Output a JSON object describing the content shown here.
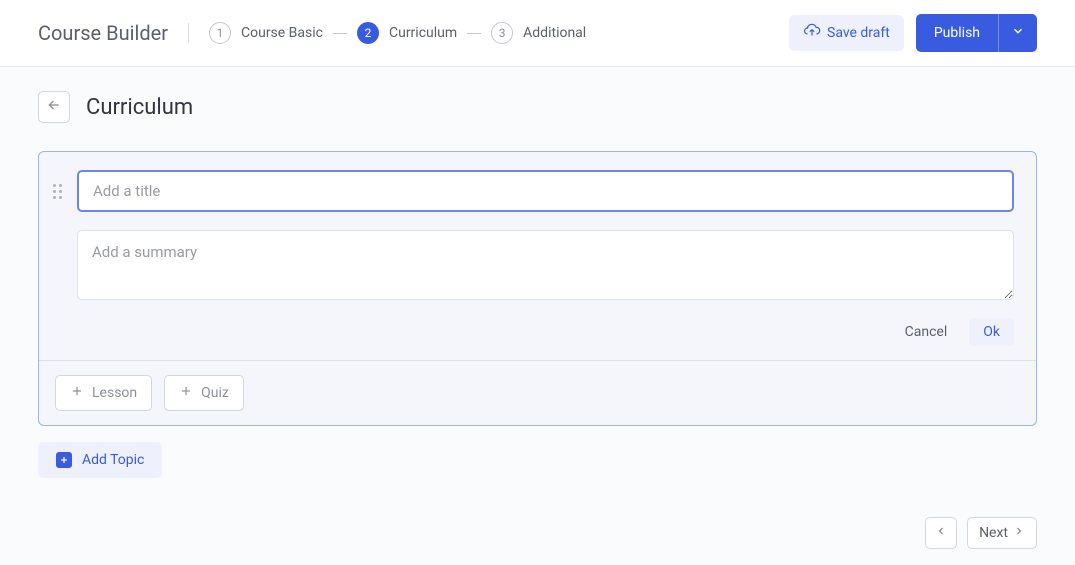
{
  "header": {
    "app_title": "Course Builder",
    "steps": [
      {
        "num": "1",
        "label": "Course Basic",
        "active": false
      },
      {
        "num": "2",
        "label": "Curriculum",
        "active": true
      },
      {
        "num": "3",
        "label": "Additional",
        "active": false
      }
    ],
    "save_draft_label": "Save draft",
    "publish_label": "Publish"
  },
  "page": {
    "title": "Curriculum"
  },
  "topic": {
    "title_placeholder": "Add a title",
    "title_value": "",
    "summary_placeholder": "Add a summary",
    "summary_value": "",
    "cancel_label": "Cancel",
    "ok_label": "Ok",
    "lesson_label": "Lesson",
    "quiz_label": "Quiz"
  },
  "add_topic_label": "Add Topic",
  "footer": {
    "next_label": "Next"
  }
}
